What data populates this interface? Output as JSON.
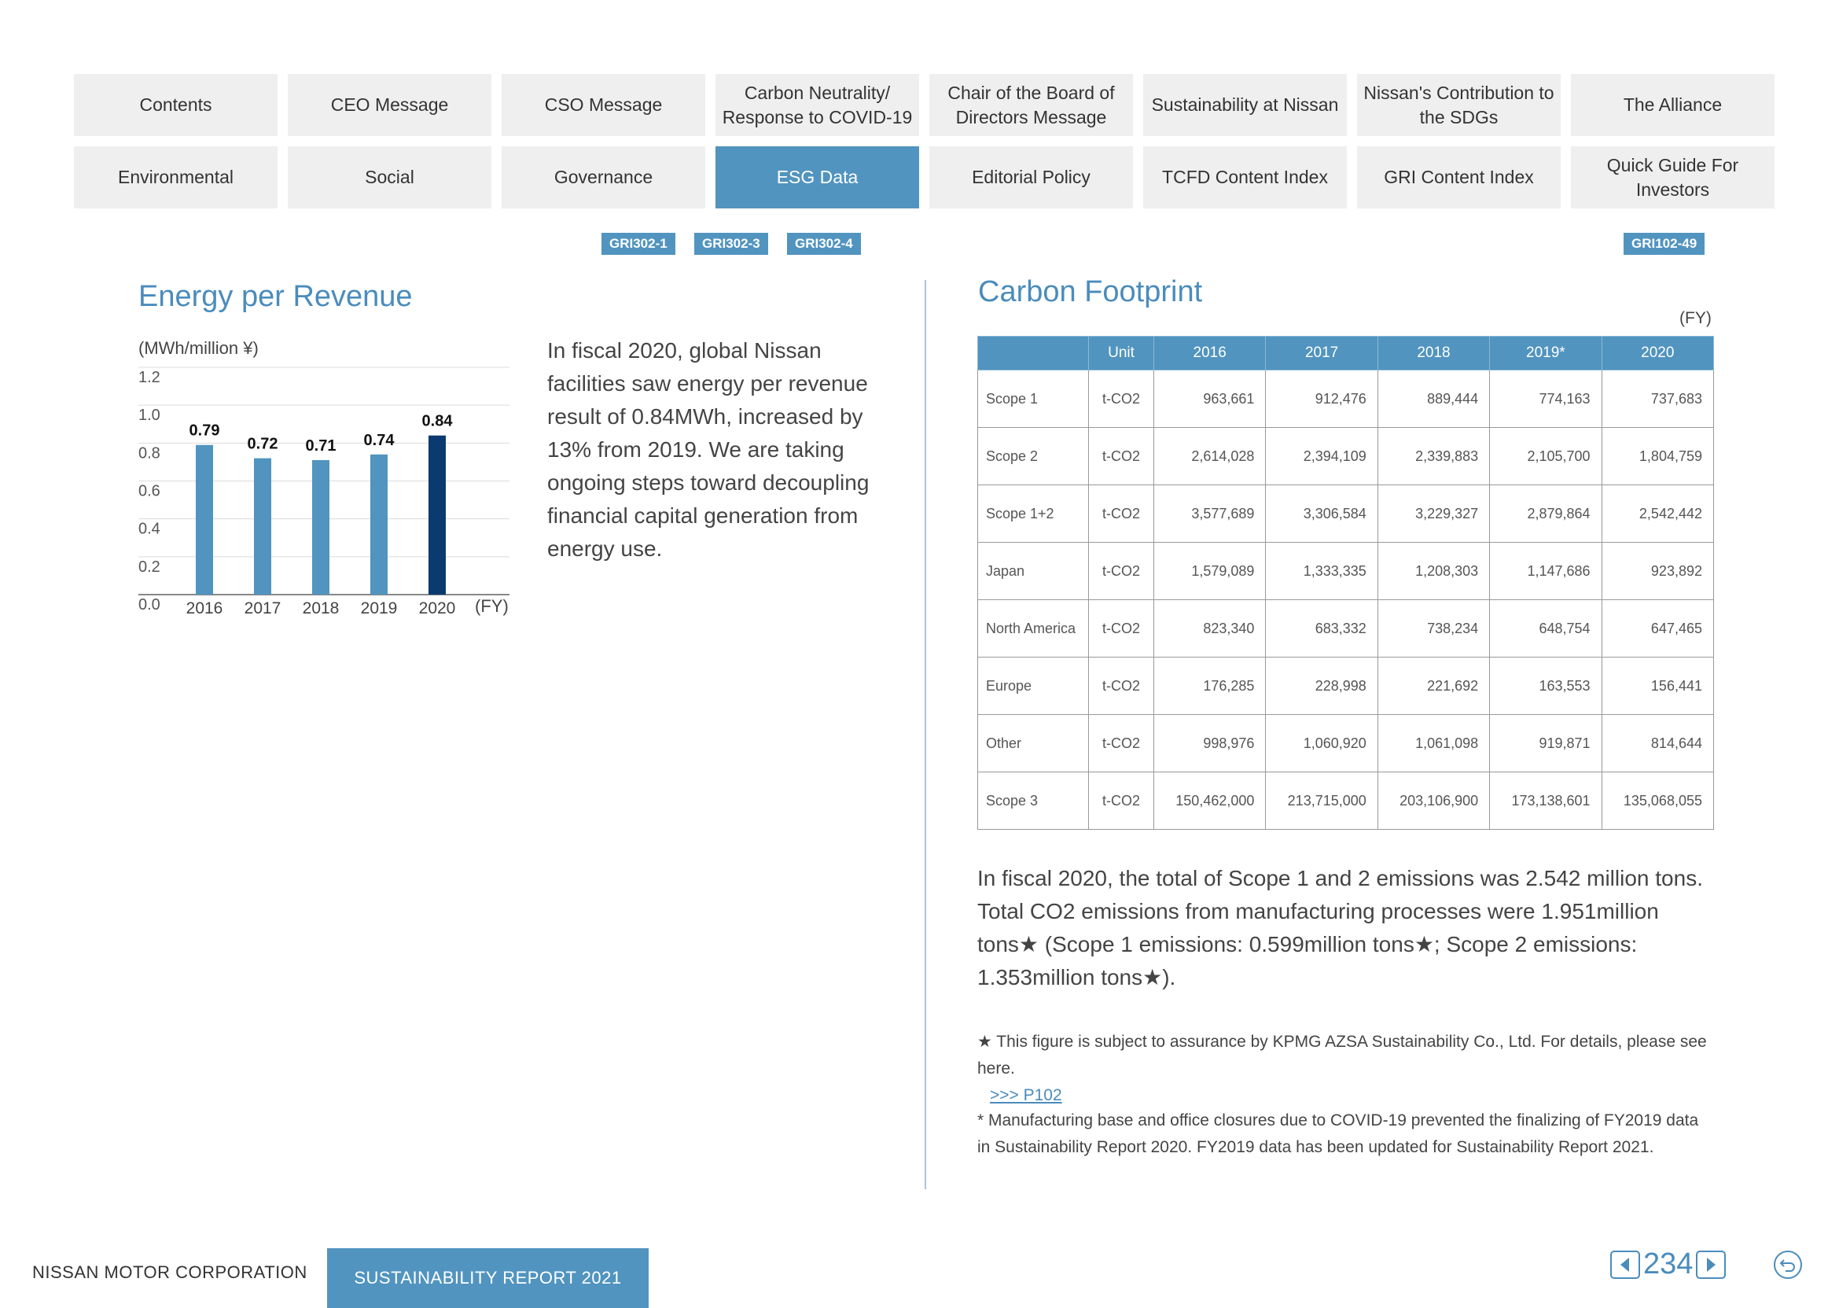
{
  "nav": {
    "row1": [
      "Contents",
      "CEO Message",
      "CSO Message",
      "Carbon Neutrality/ Response to COVID-19",
      "Chair of the Board of Directors Message",
      "Sustainability at Nissan",
      "Nissan's Contribution to the SDGs",
      "The Alliance"
    ],
    "row2": [
      "Environmental",
      "Social",
      "Governance",
      "ESG Data",
      "Editorial Policy",
      "TCFD Content Index",
      "GRI Content Index",
      "Quick Guide For Investors"
    ],
    "active": "ESG Data"
  },
  "gri_tags": {
    "left": [
      "GRI302-1",
      "GRI302-3",
      "GRI302-4"
    ],
    "right": "GRI102-49"
  },
  "energy": {
    "title": "Energy per Revenue",
    "description": "In fiscal 2020, global Nissan facilities saw energy per revenue result of 0.84MWh, increased by 13% from 2019. We are taking ongoing steps toward decoupling financial capital generation from energy use."
  },
  "chart_data": {
    "type": "bar",
    "title": "Energy per Revenue",
    "ylabel": "(MWh/million ¥)",
    "xlabel": "(FY)",
    "categories": [
      "2016",
      "2017",
      "2018",
      "2019",
      "2020"
    ],
    "values": [
      0.79,
      0.72,
      0.71,
      0.74,
      0.84
    ],
    "value_labels": [
      "0.79",
      "0.72",
      "0.71",
      "0.74",
      "0.84"
    ],
    "ylim": [
      0,
      1.2
    ],
    "yticks": [
      "0.0",
      "0.2",
      "0.4",
      "0.6",
      "0.8",
      "1.0",
      "1.2"
    ],
    "grid": true,
    "colors": {
      "default": "#5194bf",
      "highlight": "#0b3a70"
    },
    "highlight_index": 4
  },
  "carbon": {
    "title": "Carbon Footprint",
    "fy_label": "(FY)",
    "headers": [
      "",
      "Unit",
      "2016",
      "2017",
      "2018",
      "2019*",
      "2020"
    ],
    "rows": [
      {
        "label": "Scope 1",
        "unit": "t-CO2",
        "values": [
          "963,661",
          "912,476",
          "889,444",
          "774,163",
          "737,683"
        ]
      },
      {
        "label": "Scope 2",
        "unit": "t-CO2",
        "values": [
          "2,614,028",
          "2,394,109",
          "2,339,883",
          "2,105,700",
          "1,804,759"
        ]
      },
      {
        "label": "Scope 1+2",
        "unit": "t-CO2",
        "values": [
          "3,577,689",
          "3,306,584",
          "3,229,327",
          "2,879,864",
          "2,542,442"
        ]
      },
      {
        "label": "Japan",
        "unit": "t-CO2",
        "values": [
          "1,579,089",
          "1,333,335",
          "1,208,303",
          "1,147,686",
          "923,892"
        ]
      },
      {
        "label": "North America",
        "unit": "t-CO2",
        "values": [
          "823,340",
          "683,332",
          "738,234",
          "648,754",
          "647,465"
        ]
      },
      {
        "label": "Europe",
        "unit": "t-CO2",
        "values": [
          "176,285",
          "228,998",
          "221,692",
          "163,553",
          "156,441"
        ]
      },
      {
        "label": "Other",
        "unit": "t-CO2",
        "values": [
          "998,976",
          "1,060,920",
          "1,061,098",
          "919,871",
          "814,644"
        ]
      },
      {
        "label": "Scope 3",
        "unit": "t-CO2",
        "values": [
          "150,462,000",
          "213,715,000",
          "203,106,900",
          "173,138,601",
          "135,068,055"
        ]
      }
    ],
    "paragraph": "In fiscal 2020, the total of Scope 1 and 2 emissions was 2.542 million tons. Total CO2 emissions from manufacturing processes were 1.951million tons★ (Scope 1 emissions: 0.599million tons★; Scope 2 emissions: 1.353million tons★).",
    "note_star": "★ This figure is subject to assurance by KPMG AZSA Sustainability Co., Ltd. For details, please see here.",
    "note_link": ">>> P102",
    "note_asterisk": "* Manufacturing base and office closures due to COVID-19 prevented the finalizing of FY2019 data in Sustainability Report 2020. FY2019 data has been updated for Sustainability Report 2021."
  },
  "footer": {
    "company": "NISSAN MOTOR CORPORATION",
    "report": "SUSTAINABILITY REPORT 2021",
    "page": "234"
  }
}
